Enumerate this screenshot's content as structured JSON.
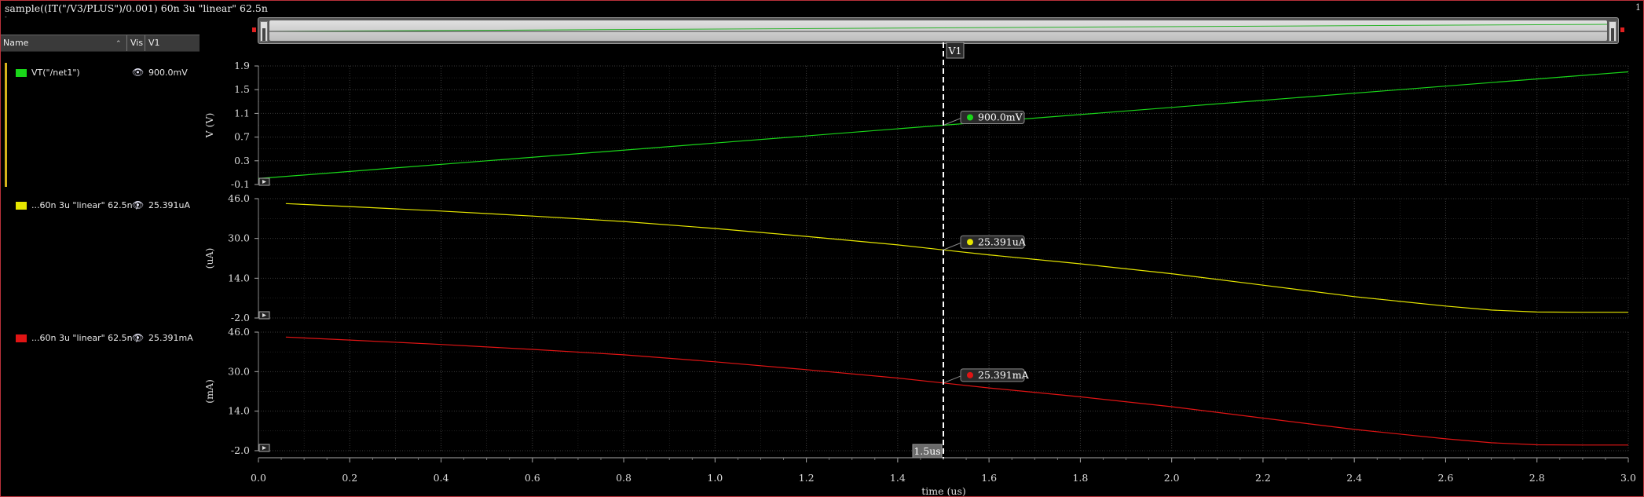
{
  "window": {
    "title": "sample((IT(\"/V3/PLUS\")/0.001) 60n 3u \"linear\" 62.5n",
    "subtitle": "-",
    "page_number": "1"
  },
  "table_header": {
    "name": "Name",
    "vis": "Vis",
    "v1": "V1"
  },
  "traces": [
    {
      "label": "VT(\"/net1\")",
      "value": "900.0mV",
      "color": "#19d619"
    },
    {
      "label": "...60n 3u \"linear\" 62.5n )",
      "value": "25.391uA",
      "color": "#e6e600"
    },
    {
      "label": "...60n 3u \"linear\" 62.5n )",
      "value": "25.391mA",
      "color": "#e01414"
    }
  ],
  "marker": {
    "name": "V1",
    "x_label": "1.5us",
    "readouts": [
      "900.0mV",
      "25.391uA",
      "25.391mA"
    ]
  },
  "chart_data": [
    {
      "type": "line",
      "ylabel": "V (V)",
      "ylim": [
        -0.1,
        1.9
      ],
      "yticks": [
        "1.9",
        "1.5",
        "1.1",
        "0.7",
        "0.3",
        "-0.1"
      ],
      "series": [
        {
          "color": "#19d619",
          "x": [
            0.0,
            0.5,
            1.0,
            1.5,
            2.0,
            2.5,
            3.0
          ],
          "y": [
            0.0,
            0.3,
            0.6,
            0.9,
            1.2,
            1.5,
            1.8
          ]
        }
      ]
    },
    {
      "type": "line",
      "ylabel": "(uA)",
      "ylim": [
        -2.0,
        46.0
      ],
      "yticks": [
        "46.0",
        "30.0",
        "14.0",
        "-2.0"
      ],
      "series": [
        {
          "color": "#e6e600",
          "x": [
            0.06,
            0.2,
            0.4,
            0.6,
            0.8,
            1.0,
            1.2,
            1.4,
            1.5,
            1.6,
            1.8,
            2.0,
            2.2,
            2.4,
            2.6,
            2.7,
            2.8,
            2.9,
            3.0
          ],
          "y": [
            44.0,
            42.8,
            41.0,
            39.0,
            36.8,
            34.0,
            30.8,
            27.4,
            25.391,
            23.4,
            19.8,
            15.8,
            11.2,
            6.6,
            2.8,
            1.2,
            0.4,
            0.3,
            0.3
          ]
        }
      ]
    },
    {
      "type": "line",
      "ylabel": "(mA)",
      "ylim": [
        -2.0,
        46.0
      ],
      "yticks": [
        "46.0",
        "30.0",
        "14.0",
        "-2.0"
      ],
      "series": [
        {
          "color": "#e01414",
          "x": [
            0.06,
            0.2,
            0.4,
            0.6,
            0.8,
            1.0,
            1.2,
            1.4,
            1.5,
            1.6,
            1.8,
            2.0,
            2.2,
            2.4,
            2.6,
            2.7,
            2.8,
            2.9,
            3.0
          ],
          "y": [
            44.0,
            42.8,
            41.0,
            39.0,
            36.8,
            34.0,
            30.8,
            27.4,
            25.391,
            23.4,
            19.8,
            15.8,
            11.2,
            6.6,
            2.8,
            1.2,
            0.4,
            0.3,
            0.3
          ]
        }
      ]
    }
  ],
  "x_axis": {
    "label": "time (us)",
    "range": [
      0.0,
      3.0
    ],
    "ticks": [
      "0.0",
      "0.2",
      "0.4",
      "0.6",
      "0.8",
      "1.0",
      "1.2",
      "1.4",
      "1.6",
      "1.8",
      "2.0",
      "2.2",
      "2.4",
      "2.6",
      "2.8",
      "3.0"
    ],
    "marker_x": 1.5
  },
  "colors": {
    "background": "#000000",
    "grid": "#3c3c3c",
    "marker_line": "#ffffff"
  }
}
